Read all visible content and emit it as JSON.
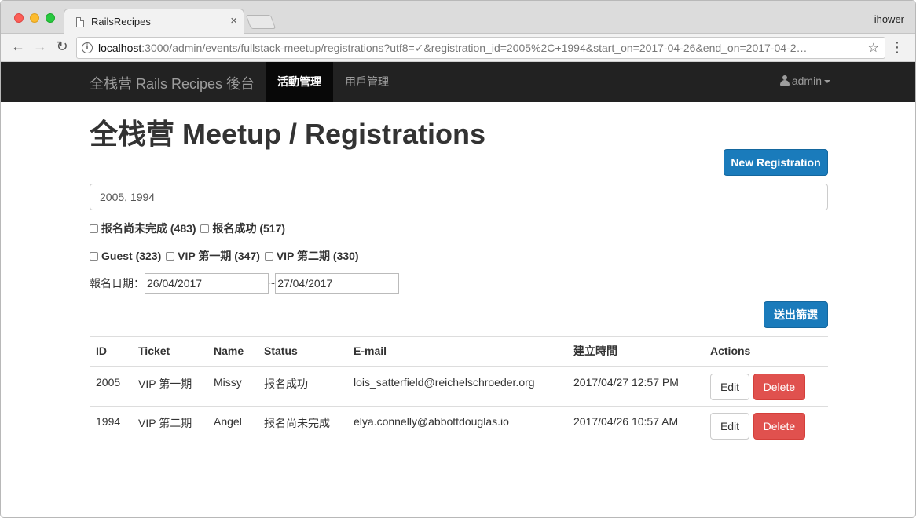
{
  "browser": {
    "tab_title": "RailsRecipes",
    "tab_close": "×",
    "profile": "ihower",
    "url_host": "localhost",
    "url_rest": ":3000/admin/events/fullstack-meetup/registrations?utf8=✓&registration_id=2005%2C+1994&start_on=2017-04-26&end_on=2017-04-2…",
    "info_glyph": "i",
    "star_glyph": "☆",
    "menu_glyph": "⋮",
    "back_glyph": "←",
    "forward_glyph": "→",
    "reload_glyph": "↻"
  },
  "navbar": {
    "brand": "全栈营 Rails Recipes 後台",
    "items": [
      {
        "label": "活動管理",
        "active": true
      },
      {
        "label": "用戶管理",
        "active": false
      }
    ],
    "user": "admin"
  },
  "page": {
    "title": "全栈营 Meetup / Registrations",
    "new_button": "New Registration",
    "search_value": "2005, 1994",
    "status_filters": [
      "报名尚未完成 (483)",
      "报名成功 (517)"
    ],
    "ticket_filters": [
      "Guest (323)",
      "VIP 第一期 (347)",
      "VIP 第二期 (330)"
    ],
    "date_label": "報名日期：",
    "start_date": "26/04/2017",
    "date_separator": "~",
    "end_date": "27/04/2017",
    "filter_button": "送出篩選"
  },
  "table": {
    "headers": [
      "ID",
      "Ticket",
      "Name",
      "Status",
      "E-mail",
      "建立時間",
      "Actions"
    ],
    "rows": [
      {
        "id": "2005",
        "ticket": "VIP 第一期",
        "name": "Missy",
        "status": "报名成功",
        "email": "lois_satterfield@reichelschroeder.org",
        "created": "2017/04/27 12:57 PM",
        "edit": "Edit",
        "delete": "Delete"
      },
      {
        "id": "1994",
        "ticket": "VIP 第二期",
        "name": "Angel",
        "status": "报名尚未完成",
        "email": "elya.connelly@abbottdouglas.io",
        "created": "2017/04/26 10:57 AM",
        "edit": "Edit",
        "delete": "Delete"
      }
    ]
  },
  "colors": {
    "navbar_bg": "#222222",
    "primary": "#1a7bbb",
    "danger": "#e0514e"
  }
}
